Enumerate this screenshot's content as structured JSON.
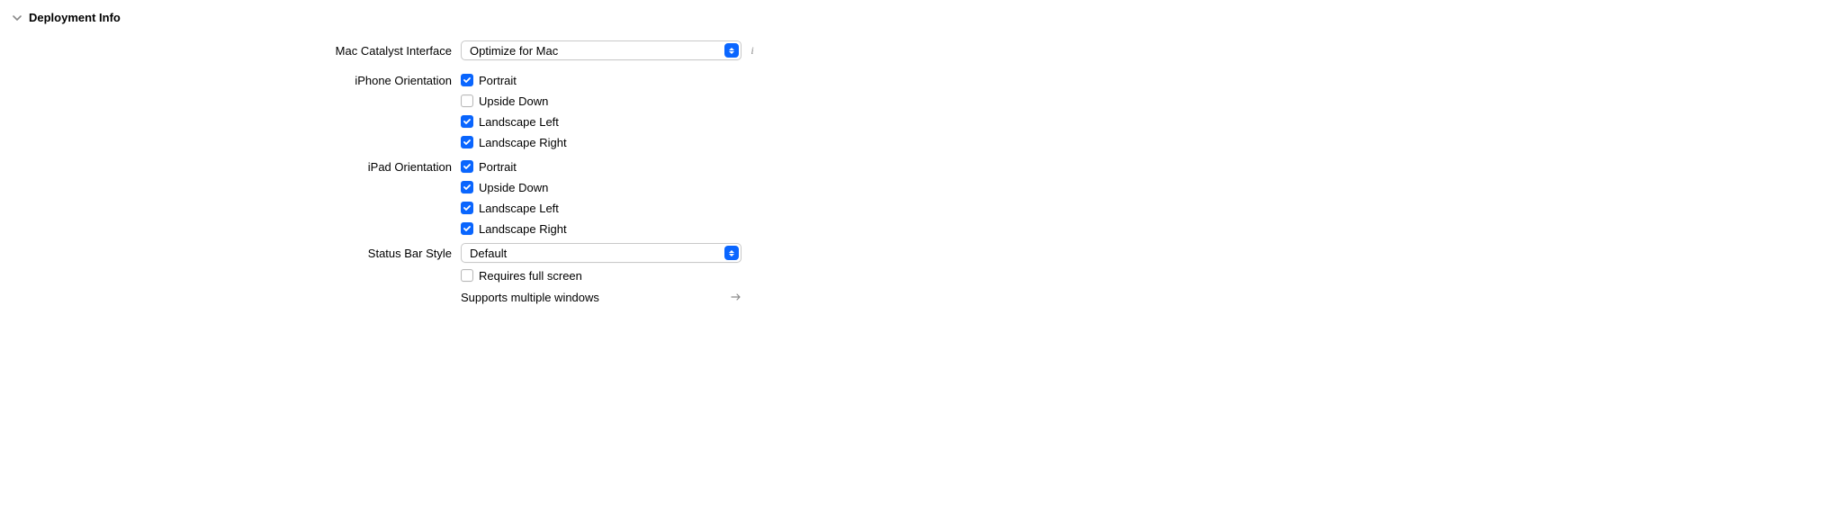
{
  "section": {
    "title": "Deployment Info"
  },
  "rows": {
    "macCatalyst": {
      "label": "Mac Catalyst Interface",
      "value": "Optimize for Mac",
      "info": "i"
    },
    "iphoneOrientation": {
      "label": "iPhone Orientation",
      "options": [
        {
          "label": "Portrait",
          "checked": true
        },
        {
          "label": "Upside Down",
          "checked": false
        },
        {
          "label": "Landscape Left",
          "checked": true
        },
        {
          "label": "Landscape Right",
          "checked": true
        }
      ]
    },
    "ipadOrientation": {
      "label": "iPad Orientation",
      "options": [
        {
          "label": "Portrait",
          "checked": true
        },
        {
          "label": "Upside Down",
          "checked": true
        },
        {
          "label": "Landscape Left",
          "checked": true
        },
        {
          "label": "Landscape Right",
          "checked": true
        }
      ]
    },
    "statusBar": {
      "label": "Status Bar Style",
      "value": "Default",
      "requiresFullScreen": {
        "label": "Requires full screen",
        "checked": false
      },
      "supportsMultipleWindows": {
        "label": "Supports multiple windows"
      }
    }
  }
}
